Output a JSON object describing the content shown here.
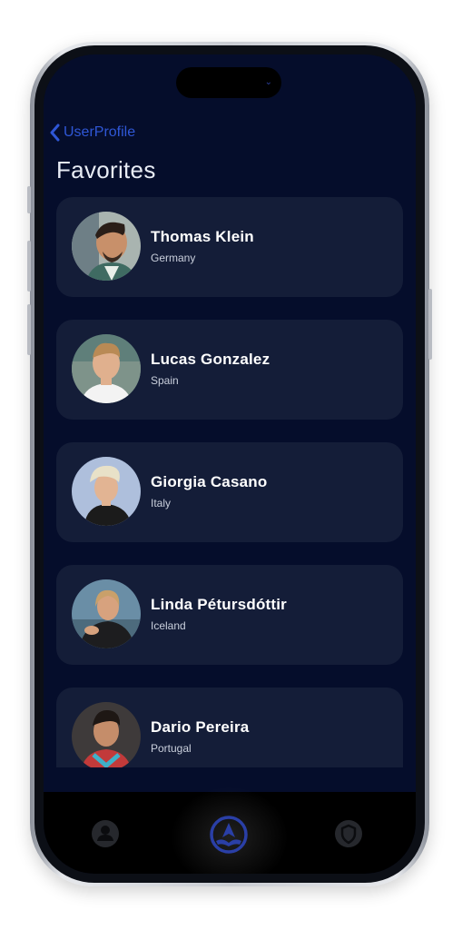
{
  "nav": {
    "back_label": "UserProfile"
  },
  "page": {
    "title": "Favorites"
  },
  "favorites": [
    {
      "name": "Thomas Klein",
      "country": "Germany"
    },
    {
      "name": "Lucas Gonzalez",
      "country": "Spain"
    },
    {
      "name": "Giorgia Casano",
      "country": "Italy"
    },
    {
      "name": "Linda Pétursdóttir",
      "country": "Iceland"
    },
    {
      "name": "Dario Pereira",
      "country": "Portugal"
    }
  ],
  "tabs": [
    {
      "icon": "person-icon",
      "active": false
    },
    {
      "icon": "soccer-ball-icon",
      "active": true
    },
    {
      "icon": "shield-icon",
      "active": false
    }
  ],
  "colors": {
    "background": "#050d2b",
    "card": "#141d38",
    "accent": "#2f57d6",
    "tabbar": "#000000"
  }
}
